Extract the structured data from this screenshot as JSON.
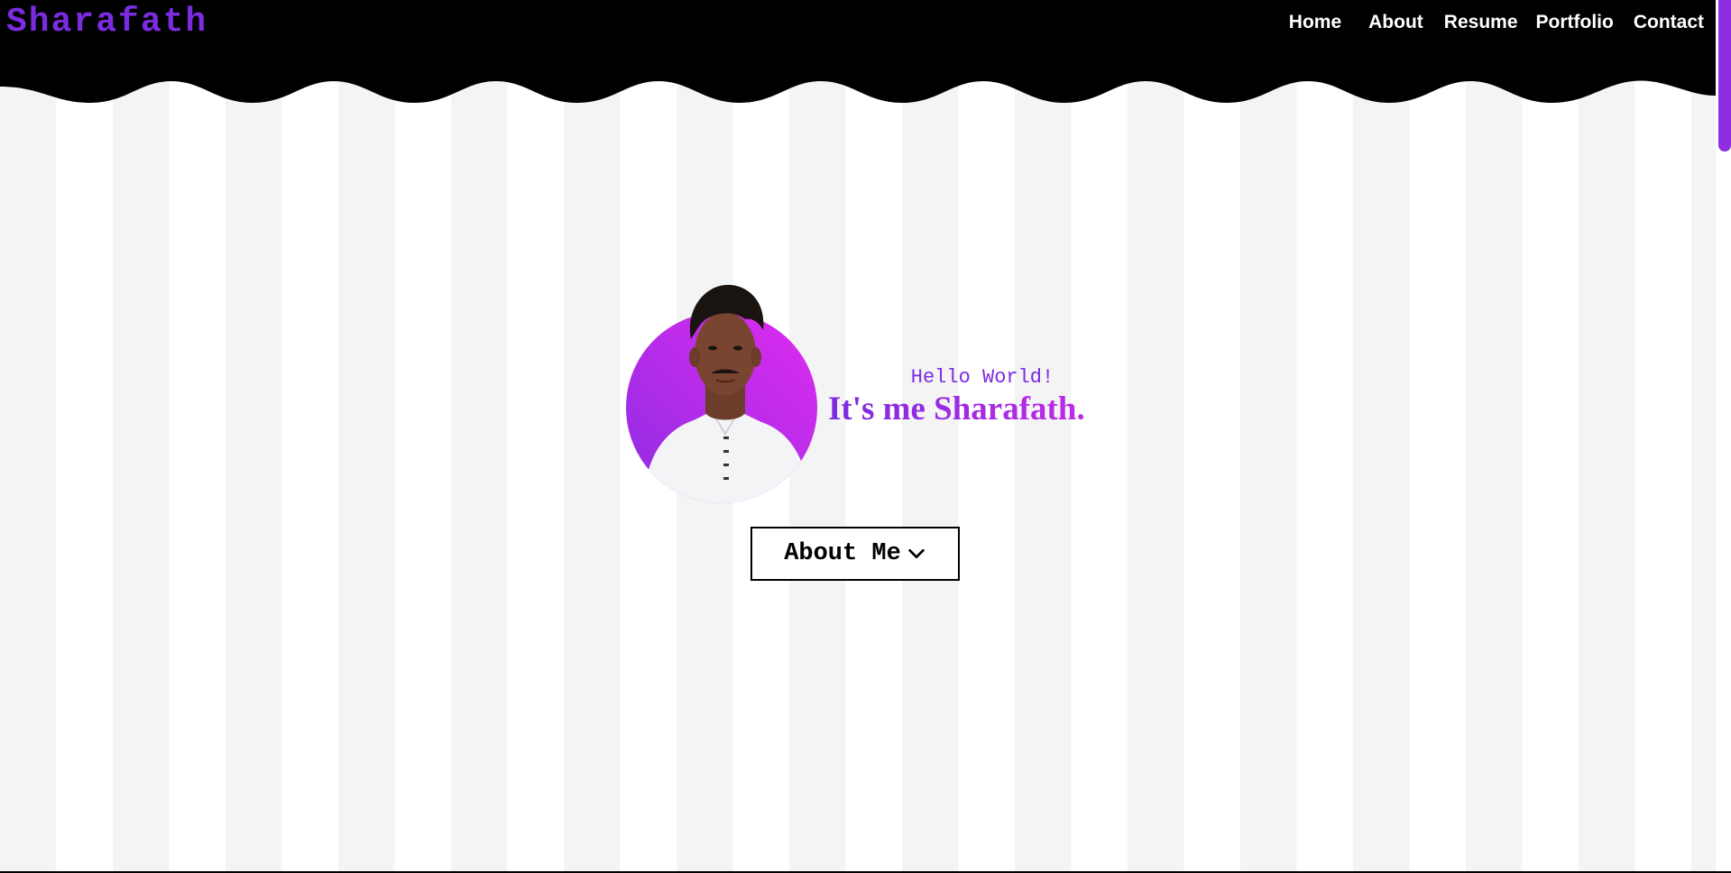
{
  "header": {
    "logo": "Sharafath",
    "nav": [
      {
        "label": "Home"
      },
      {
        "label": "About"
      },
      {
        "label": "Resume"
      },
      {
        "label": "Portfolio"
      },
      {
        "label": "Contact"
      }
    ]
  },
  "hero": {
    "greeting": "Hello World!",
    "title": "It's me Sharafath.",
    "button_label": "About Me",
    "button_icon": "chevron-down-icon"
  },
  "colors": {
    "accent_purple": "#7b2be0",
    "accent_magenta": "#c12be8",
    "header_bg": "#000000",
    "stripe_light": "#f4f4f4",
    "stripe_white": "#ffffff"
  }
}
